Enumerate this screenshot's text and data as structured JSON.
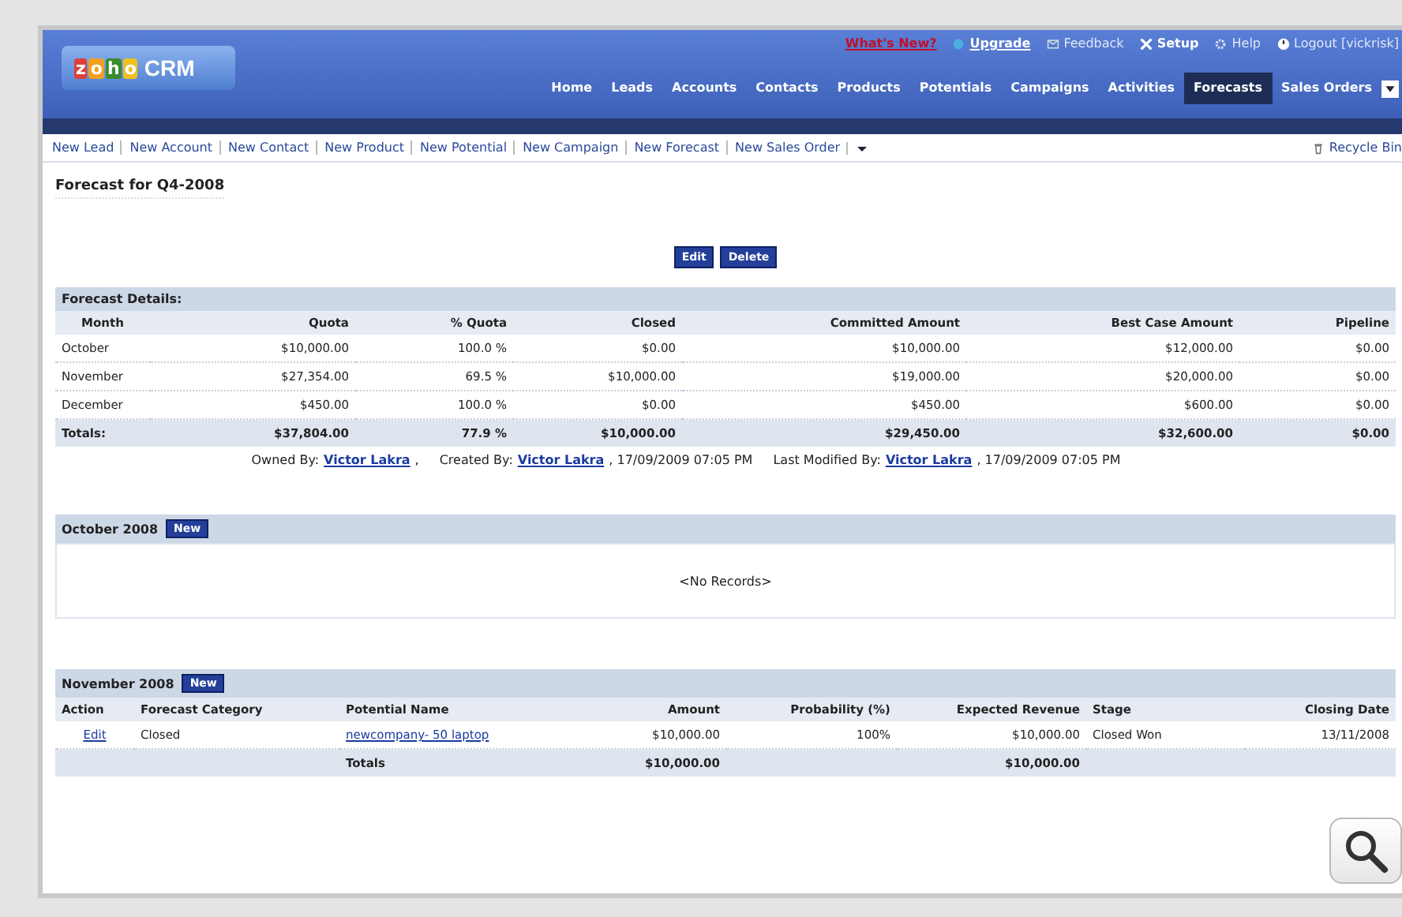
{
  "logo": {
    "letters": "zoho",
    "word": "CRM"
  },
  "top_links": [
    {
      "kind": "whatsnew",
      "label": "What's New?"
    },
    {
      "kind": "upgrade",
      "label": "Upgrade"
    },
    {
      "kind": "feedback",
      "label": "Feedback"
    },
    {
      "kind": "setup",
      "label": "Setup"
    },
    {
      "kind": "help",
      "label": "Help"
    },
    {
      "kind": "logout",
      "label": "Logout [vickrisk]"
    }
  ],
  "tabs": [
    {
      "label": "Home",
      "selected": false
    },
    {
      "label": "Leads",
      "selected": false
    },
    {
      "label": "Accounts",
      "selected": false
    },
    {
      "label": "Contacts",
      "selected": false
    },
    {
      "label": "Products",
      "selected": false
    },
    {
      "label": "Potentials",
      "selected": false
    },
    {
      "label": "Campaigns",
      "selected": false
    },
    {
      "label": "Activities",
      "selected": false
    },
    {
      "label": "Forecasts",
      "selected": true
    },
    {
      "label": "Sales Orders",
      "selected": false
    }
  ],
  "quick_links": [
    "New Lead",
    "New Account",
    "New Contact",
    "New Product",
    "New Potential",
    "New Campaign",
    "New Forecast",
    "New Sales Order"
  ],
  "recycle_bin": "Recycle Bin",
  "title": "Forecast for Q4-2008",
  "buttons": [
    "Edit",
    "Delete"
  ],
  "details": {
    "heading": "Forecast Details:",
    "columns": [
      "Month",
      "Quota",
      "% Quota",
      "Closed",
      "Committed Amount",
      "Best Case Amount",
      "Pipeline"
    ],
    "rows": [
      [
        "October",
        "$10,000.00",
        "100.0 %",
        "$0.00",
        "$10,000.00",
        "$12,000.00",
        "$0.00"
      ],
      [
        "November",
        "$27,354.00",
        "69.5 %",
        "$10,000.00",
        "$19,000.00",
        "$20,000.00",
        "$0.00"
      ],
      [
        "December",
        "$450.00",
        "100.0 %",
        "$0.00",
        "$450.00",
        "$600.00",
        "$0.00"
      ]
    ],
    "totals": [
      "Totals:",
      "$37,804.00",
      "77.9 %",
      "$10,000.00",
      "$29,450.00",
      "$32,600.00",
      "$0.00"
    ]
  },
  "audit": [
    {
      "label": "Owned By:",
      "user": "Victor Lakra",
      "suffix": ","
    },
    {
      "label": "Created By:",
      "user": "Victor Lakra",
      "suffix": ", 17/09/2009 07:05 PM"
    },
    {
      "label": "Last Modified By:",
      "user": "Victor Lakra",
      "suffix": ", 17/09/2009 07:05 PM"
    }
  ],
  "october": {
    "heading": "October 2008",
    "new_button": "New",
    "empty": "<No Records>"
  },
  "november": {
    "heading": "November 2008",
    "new_button": "New",
    "columns": [
      "Action",
      "Forecast Category",
      "Potential Name",
      "Amount",
      "Probability (%)",
      "Expected Revenue",
      "Stage",
      "Closing Date"
    ],
    "rows": [
      {
        "action": "Edit",
        "category": "Closed",
        "potential": "newcompany- 50 laptop",
        "amount": "$10,000.00",
        "probability": "100%",
        "expected": "$10,000.00",
        "stage": "Closed Won",
        "closing": "13/11/2008"
      }
    ],
    "totals": {
      "label": "Totals",
      "amount": "$10,000.00",
      "expected": "$10,000.00"
    }
  }
}
